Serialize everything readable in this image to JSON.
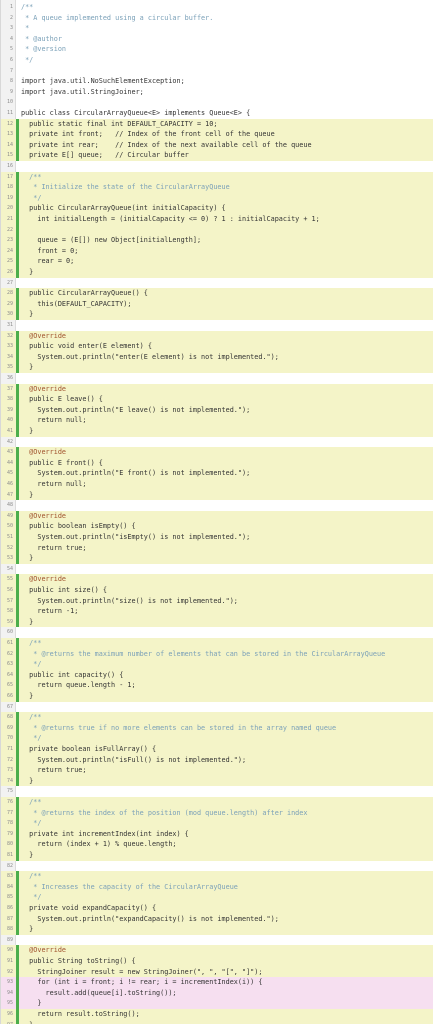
{
  "code": {
    "lines": [
      {
        "n": "1",
        "t": "/**",
        "cls": "cm",
        "hl": ""
      },
      {
        "n": "2",
        "t": " * A queue implemented using a circular buffer.",
        "cls": "cm",
        "hl": ""
      },
      {
        "n": "3",
        "t": " *",
        "cls": "cm",
        "hl": ""
      },
      {
        "n": "4",
        "t": " * @author",
        "cls": "cm",
        "hl": ""
      },
      {
        "n": "5",
        "t": " * @version",
        "cls": "cm",
        "hl": ""
      },
      {
        "n": "6",
        "t": " */",
        "cls": "cm",
        "hl": ""
      },
      {
        "n": "7",
        "t": "",
        "cls": "",
        "hl": ""
      },
      {
        "n": "8",
        "t": "import java.util.NoSuchElementException;",
        "cls": "",
        "hl": ""
      },
      {
        "n": "9",
        "t": "import java.util.StringJoiner;",
        "cls": "",
        "hl": ""
      },
      {
        "n": "10",
        "t": "",
        "cls": "",
        "hl": ""
      },
      {
        "n": "11",
        "t": "public class CircularArrayQueue<E> implements Queue<E> {",
        "cls": "",
        "hl": ""
      },
      {
        "n": "12",
        "t": "  public static final int DEFAULT_CAPACITY = 10;",
        "cls": "",
        "hl": "y"
      },
      {
        "n": "13",
        "t": "  private int front;   // Index of the front cell of the queue",
        "cls": "",
        "hl": "y"
      },
      {
        "n": "14",
        "t": "  private int rear;    // Index of the next available cell of the queue",
        "cls": "",
        "hl": "y"
      },
      {
        "n": "15",
        "t": "  private E[] queue;   // Circular buffer",
        "cls": "",
        "hl": "y"
      },
      {
        "n": "16",
        "t": "",
        "cls": "",
        "hl": ""
      },
      {
        "n": "17",
        "t": "  /**",
        "cls": "cm",
        "hl": "y"
      },
      {
        "n": "18",
        "t": "   * Initialize the state of the CircularArrayQueue",
        "cls": "cm",
        "hl": "y"
      },
      {
        "n": "19",
        "t": "   */",
        "cls": "cm",
        "hl": "y"
      },
      {
        "n": "20",
        "t": "  public CircularArrayQueue(int initialCapacity) {",
        "cls": "",
        "hl": "y"
      },
      {
        "n": "21",
        "t": "    int initialLength = (initialCapacity <= 0) ? 1 : initialCapacity + 1;",
        "cls": "",
        "hl": "y"
      },
      {
        "n": "22",
        "t": "",
        "cls": "",
        "hl": "y"
      },
      {
        "n": "23",
        "t": "    queue = (E[]) new Object[initialLength];",
        "cls": "",
        "hl": "y"
      },
      {
        "n": "24",
        "t": "    front = 0;",
        "cls": "",
        "hl": "y"
      },
      {
        "n": "25",
        "t": "    rear = 0;",
        "cls": "",
        "hl": "y"
      },
      {
        "n": "26",
        "t": "  }",
        "cls": "",
        "hl": "y"
      },
      {
        "n": "27",
        "t": "",
        "cls": "",
        "hl": ""
      },
      {
        "n": "28",
        "t": "  public CircularArrayQueue() {",
        "cls": "",
        "hl": "y"
      },
      {
        "n": "29",
        "t": "    this(DEFAULT_CAPACITY);",
        "cls": "",
        "hl": "y"
      },
      {
        "n": "30",
        "t": "  }",
        "cls": "",
        "hl": "y"
      },
      {
        "n": "31",
        "t": "",
        "cls": "",
        "hl": ""
      },
      {
        "n": "32",
        "t": "  @Override",
        "cls": "an",
        "hl": "y"
      },
      {
        "n": "33",
        "t": "  public void enter(E element) {",
        "cls": "",
        "hl": "y"
      },
      {
        "n": "34",
        "t": "    System.out.println(\"enter(E element) is not implemented.\");",
        "cls": "",
        "hl": "y"
      },
      {
        "n": "35",
        "t": "  }",
        "cls": "",
        "hl": "y"
      },
      {
        "n": "36",
        "t": "",
        "cls": "",
        "hl": ""
      },
      {
        "n": "37",
        "t": "  @Override",
        "cls": "an",
        "hl": "y"
      },
      {
        "n": "38",
        "t": "  public E leave() {",
        "cls": "",
        "hl": "y"
      },
      {
        "n": "39",
        "t": "    System.out.println(\"E leave() is not implemented.\");",
        "cls": "",
        "hl": "y"
      },
      {
        "n": "40",
        "t": "    return null;",
        "cls": "",
        "hl": "y"
      },
      {
        "n": "41",
        "t": "  }",
        "cls": "",
        "hl": "y"
      },
      {
        "n": "42",
        "t": "",
        "cls": "",
        "hl": ""
      },
      {
        "n": "43",
        "t": "  @Override",
        "cls": "an",
        "hl": "y"
      },
      {
        "n": "44",
        "t": "  public E front() {",
        "cls": "",
        "hl": "y"
      },
      {
        "n": "45",
        "t": "    System.out.println(\"E front() is not implemented.\");",
        "cls": "",
        "hl": "y"
      },
      {
        "n": "46",
        "t": "    return null;",
        "cls": "",
        "hl": "y"
      },
      {
        "n": "47",
        "t": "  }",
        "cls": "",
        "hl": "y"
      },
      {
        "n": "48",
        "t": "",
        "cls": "",
        "hl": ""
      },
      {
        "n": "49",
        "t": "  @Override",
        "cls": "an",
        "hl": "y"
      },
      {
        "n": "50",
        "t": "  public boolean isEmpty() {",
        "cls": "",
        "hl": "y"
      },
      {
        "n": "51",
        "t": "    System.out.println(\"isEmpty() is not implemented.\");",
        "cls": "",
        "hl": "y"
      },
      {
        "n": "52",
        "t": "    return true;",
        "cls": "",
        "hl": "y"
      },
      {
        "n": "53",
        "t": "  }",
        "cls": "",
        "hl": "y"
      },
      {
        "n": "54",
        "t": "",
        "cls": "",
        "hl": ""
      },
      {
        "n": "55",
        "t": "  @Override",
        "cls": "an",
        "hl": "y"
      },
      {
        "n": "56",
        "t": "  public int size() {",
        "cls": "",
        "hl": "y"
      },
      {
        "n": "57",
        "t": "    System.out.println(\"size() is not implemented.\");",
        "cls": "",
        "hl": "y"
      },
      {
        "n": "58",
        "t": "    return -1;",
        "cls": "",
        "hl": "y"
      },
      {
        "n": "59",
        "t": "  }",
        "cls": "",
        "hl": "y"
      },
      {
        "n": "60",
        "t": "",
        "cls": "",
        "hl": ""
      },
      {
        "n": "61",
        "t": "  /**",
        "cls": "cm",
        "hl": "y"
      },
      {
        "n": "62",
        "t": "   * @returns the maximum number of elements that can be stored in the CircularArrayQueue",
        "cls": "cm",
        "hl": "y"
      },
      {
        "n": "63",
        "t": "   */",
        "cls": "cm",
        "hl": "y"
      },
      {
        "n": "64",
        "t": "  public int capacity() {",
        "cls": "",
        "hl": "y"
      },
      {
        "n": "65",
        "t": "    return queue.length - 1;",
        "cls": "",
        "hl": "y"
      },
      {
        "n": "66",
        "t": "  }",
        "cls": "",
        "hl": "y"
      },
      {
        "n": "67",
        "t": "",
        "cls": "",
        "hl": ""
      },
      {
        "n": "68",
        "t": "  /**",
        "cls": "cm",
        "hl": "y"
      },
      {
        "n": "69",
        "t": "   * @returns true if no more elements can be stored in the array named queue",
        "cls": "cm",
        "hl": "y"
      },
      {
        "n": "70",
        "t": "   */",
        "cls": "cm",
        "hl": "y"
      },
      {
        "n": "71",
        "t": "  private boolean isFullArray() {",
        "cls": "",
        "hl": "y"
      },
      {
        "n": "72",
        "t": "    System.out.println(\"isFull() is not implemented.\");",
        "cls": "",
        "hl": "y"
      },
      {
        "n": "73",
        "t": "    return true;",
        "cls": "",
        "hl": "y"
      },
      {
        "n": "74",
        "t": "  }",
        "cls": "",
        "hl": "y"
      },
      {
        "n": "75",
        "t": "",
        "cls": "",
        "hl": ""
      },
      {
        "n": "76",
        "t": "  /**",
        "cls": "cm",
        "hl": "y"
      },
      {
        "n": "77",
        "t": "   * @returns the index of the position (mod queue.length) after index",
        "cls": "cm",
        "hl": "y"
      },
      {
        "n": "78",
        "t": "   */",
        "cls": "cm",
        "hl": "y"
      },
      {
        "n": "79",
        "t": "  private int incrementIndex(int index) {",
        "cls": "",
        "hl": "y"
      },
      {
        "n": "80",
        "t": "    return (index + 1) % queue.length;",
        "cls": "",
        "hl": "y"
      },
      {
        "n": "81",
        "t": "  }",
        "cls": "",
        "hl": "y"
      },
      {
        "n": "82",
        "t": "",
        "cls": "",
        "hl": ""
      },
      {
        "n": "83",
        "t": "  /**",
        "cls": "cm",
        "hl": "y"
      },
      {
        "n": "84",
        "t": "   * Increases the capacity of the CircularArrayQueue",
        "cls": "cm",
        "hl": "y"
      },
      {
        "n": "85",
        "t": "   */",
        "cls": "cm",
        "hl": "y"
      },
      {
        "n": "86",
        "t": "  private void expandCapacity() {",
        "cls": "",
        "hl": "y"
      },
      {
        "n": "87",
        "t": "    System.out.println(\"expandCapacity() is not implemented.\");",
        "cls": "",
        "hl": "y"
      },
      {
        "n": "88",
        "t": "  }",
        "cls": "",
        "hl": "y"
      },
      {
        "n": "89",
        "t": "",
        "cls": "",
        "hl": ""
      },
      {
        "n": "90",
        "t": "  @Override",
        "cls": "an",
        "hl": "y"
      },
      {
        "n": "91",
        "t": "  public String toString() {",
        "cls": "",
        "hl": "y"
      },
      {
        "n": "92",
        "t": "    StringJoiner result = new StringJoiner(\", \", \"[\", \"]\");",
        "cls": "",
        "hl": "y"
      },
      {
        "n": "93",
        "t": "    for (int i = front; i != rear; i = incrementIndex(i)) {",
        "cls": "",
        "hl": "p"
      },
      {
        "n": "94",
        "t": "      result.add(queue[i].toString());",
        "cls": "",
        "hl": "p"
      },
      {
        "n": "95",
        "t": "    }",
        "cls": "",
        "hl": "p"
      },
      {
        "n": "96",
        "t": "    return result.toString();",
        "cls": "",
        "hl": "y"
      },
      {
        "n": "97",
        "t": "  }",
        "cls": "",
        "hl": "y"
      },
      {
        "n": "98",
        "t": "}",
        "cls": "",
        "hl": "g"
      }
    ]
  }
}
